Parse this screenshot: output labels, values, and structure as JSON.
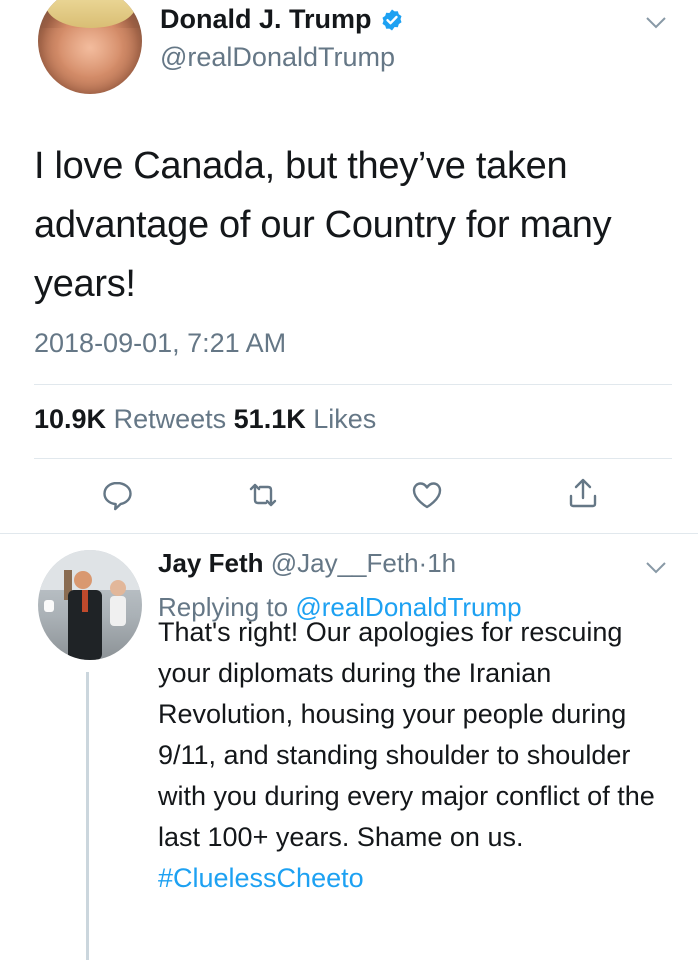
{
  "main_tweet": {
    "name": "Donald J. Trump",
    "handle": "@realDonaldTrump",
    "text": "I love Canada, but they’ve taken advantage of our Country for many years!",
    "timestamp": "2018-09-01, 7:21 AM",
    "retweets_count": "10.9K",
    "retweets_label": "Retweets",
    "likes_count": "51.1K",
    "likes_label": "Likes"
  },
  "reply": {
    "name": "Jay Feth",
    "handle": "@Jay__Feth",
    "separator": "·",
    "time": "1h",
    "replying_prefix": "Replying to",
    "replying_to": "@realDonaldTrump",
    "text": "That's right! Our apologies for rescuing your diplomats during the Iranian Revolution, housing your people during 9/11, and standing shoulder to shoulder with you during every major conflict of the last 100+ years. Shame on us.",
    "hashtag": "#CluelessCheeto"
  },
  "icons": [
    "verified-badge-icon",
    "chevron-down-icon",
    "reply-icon",
    "retweet-icon",
    "like-icon",
    "share-icon"
  ],
  "colors": {
    "link_blue": "#1da1f2",
    "secondary_text": "#657786",
    "primary_text": "#14171a",
    "divider": "#e1e8ed"
  }
}
